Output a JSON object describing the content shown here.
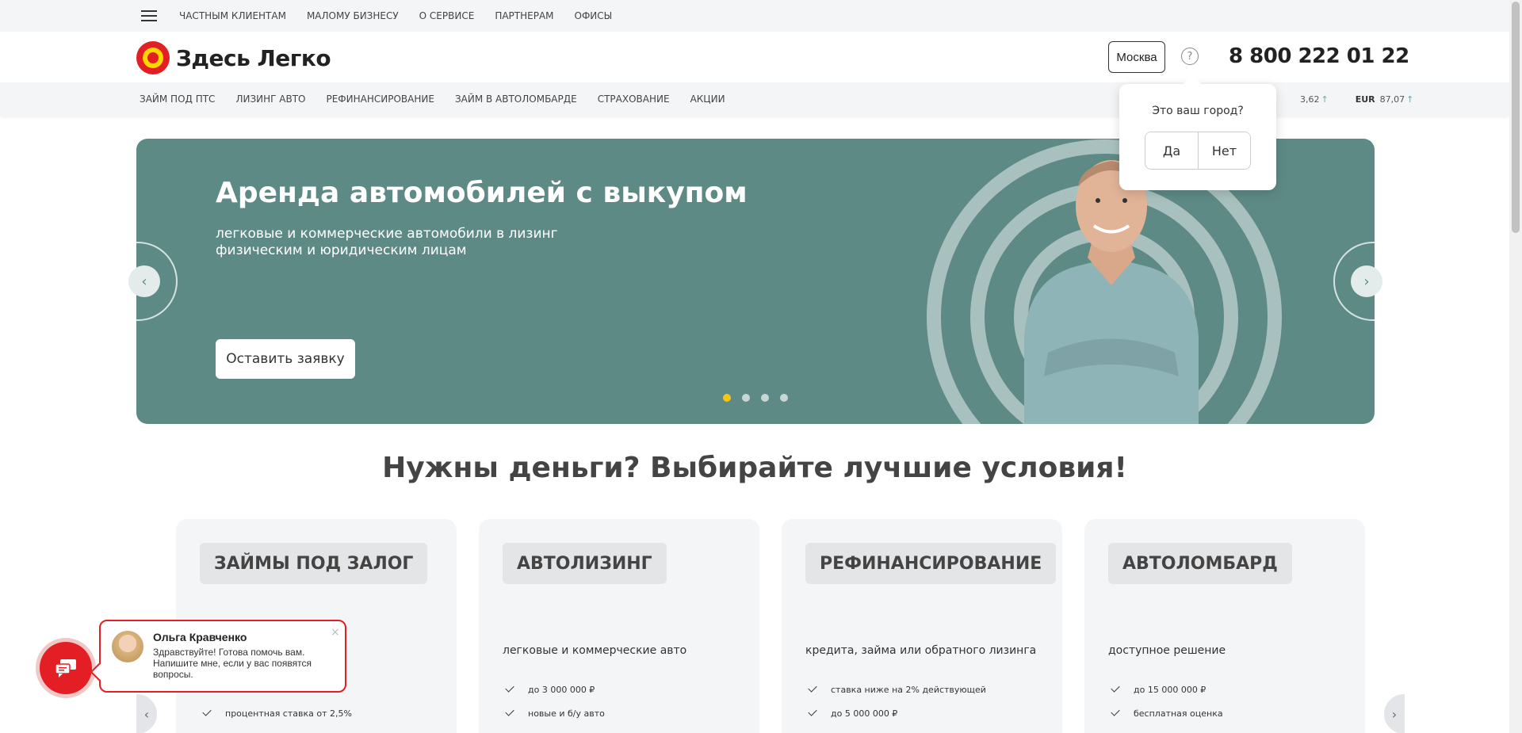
{
  "topnav": {
    "items": [
      "ЧАСТНЫМ КЛИЕНТАМ",
      "МАЛОМУ БИЗНЕСУ",
      "О СЕРВИСЕ",
      "ПАРТНЕРАМ",
      "ОФИСЫ"
    ]
  },
  "header": {
    "logo_text": "Здесь Легко",
    "city": "Москва",
    "help_symbol": "?",
    "phone": "8 800 222 01 22"
  },
  "subnav": {
    "items": [
      "ЗАЙМ ПОД ПТС",
      "ЛИЗИНГ АВТО",
      "РЕФИНАНСИРОВАНИЕ",
      "ЗАЙМ В АВТОЛОМБАРДЕ",
      "СТРАХОВАНИЕ",
      "АКЦИИ"
    ],
    "rates": [
      {
        "code": "",
        "value": "3,62",
        "arrow": "↑"
      },
      {
        "code": "EUR",
        "value": "87,07",
        "arrow": "↑"
      }
    ]
  },
  "city_popup": {
    "question": "Это ваш город?",
    "yes": "Да",
    "no": "Нет"
  },
  "hero": {
    "title": "Аренда автомобилей с выкупом",
    "subtitle": "легковые и коммерческие автомобили в лизинг физическим и юридическим лицам",
    "button": "Оставить заявку",
    "slides_total": 4,
    "active_slide": 1,
    "prev_arrow": "‹",
    "next_arrow": "›"
  },
  "section": {
    "title": "Нужны деньги? Выбирайте лучшие условия!"
  },
  "cards": [
    {
      "title": "ЗАЙМЫ ПОД ЗАЛОГ",
      "desc": "",
      "features": [
        "",
        "процентная ставка от 2,5%"
      ]
    },
    {
      "title": "АВТОЛИЗИНГ",
      "desc": "легковые и коммерческие авто",
      "features": [
        "до 3 000 000 ₽",
        "новые и б/у авто"
      ]
    },
    {
      "title": "РЕФИНАНСИРОВАНИЕ",
      "desc": "кредита, займа или обратного лизинга",
      "features": [
        "ставка ниже на 2% действующей",
        "до 5 000 000 ₽"
      ]
    },
    {
      "title": "АВТОЛОМБАРД",
      "desc": "доступное решение",
      "features": [
        "до 15 000 000 ₽",
        "бесплатная оценка"
      ]
    }
  ],
  "cards_nav": {
    "prev": "‹",
    "next": "›"
  },
  "chat": {
    "name": "Ольга Кравченко",
    "message": "Здравствуйте! Готова помочь вам. Напишите мне, если у вас появятся вопросы.",
    "close": "×"
  },
  "colors": {
    "brand_red": "#e31e24",
    "brand_yellow": "#ffd500",
    "hero_bg": "#5e8a86"
  }
}
